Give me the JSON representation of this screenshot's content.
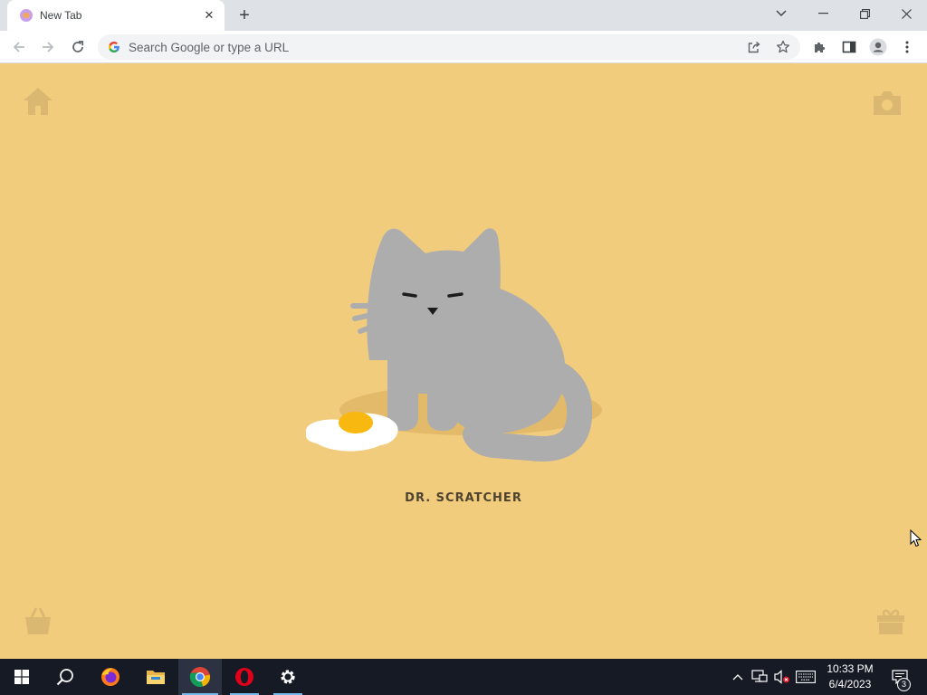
{
  "browser": {
    "tab": {
      "title": "New Tab",
      "close_glyph": "✕",
      "favicon": "scratcher-cat-icon"
    },
    "new_tab_glyph": "+",
    "window_controls": {
      "list_tabs_glyph": "⌄",
      "minimize_glyph": "—",
      "restore_glyph": "❐",
      "close_glyph": "✕"
    },
    "omnibox": {
      "placeholder": "Search Google or type a URL"
    },
    "toolbar_icons": [
      "back-icon",
      "forward-icon",
      "reload-icon",
      "share-icon",
      "bookmark-star-icon",
      "extensions-puzzle-icon",
      "side-panel-icon",
      "profile-icon",
      "menu-kebab-icon"
    ]
  },
  "page": {
    "background_color": "#f2cc7d",
    "cat_name": "DR. SCRATCHER",
    "corner_icons": [
      "home-icon",
      "camera-icon",
      "shop-bag-icon",
      "gift-icon"
    ],
    "illustration": "gray-cat-with-fried-egg"
  },
  "taskbar": {
    "apps": [
      "windows-start-icon",
      "search-icon",
      "firefox-icon",
      "file-explorer-icon",
      "chrome-icon",
      "opera-icon",
      "settings-gear-icon"
    ],
    "clock": {
      "time": "10:33 PM",
      "date": "6/4/2023"
    },
    "notification_count": "3"
  }
}
